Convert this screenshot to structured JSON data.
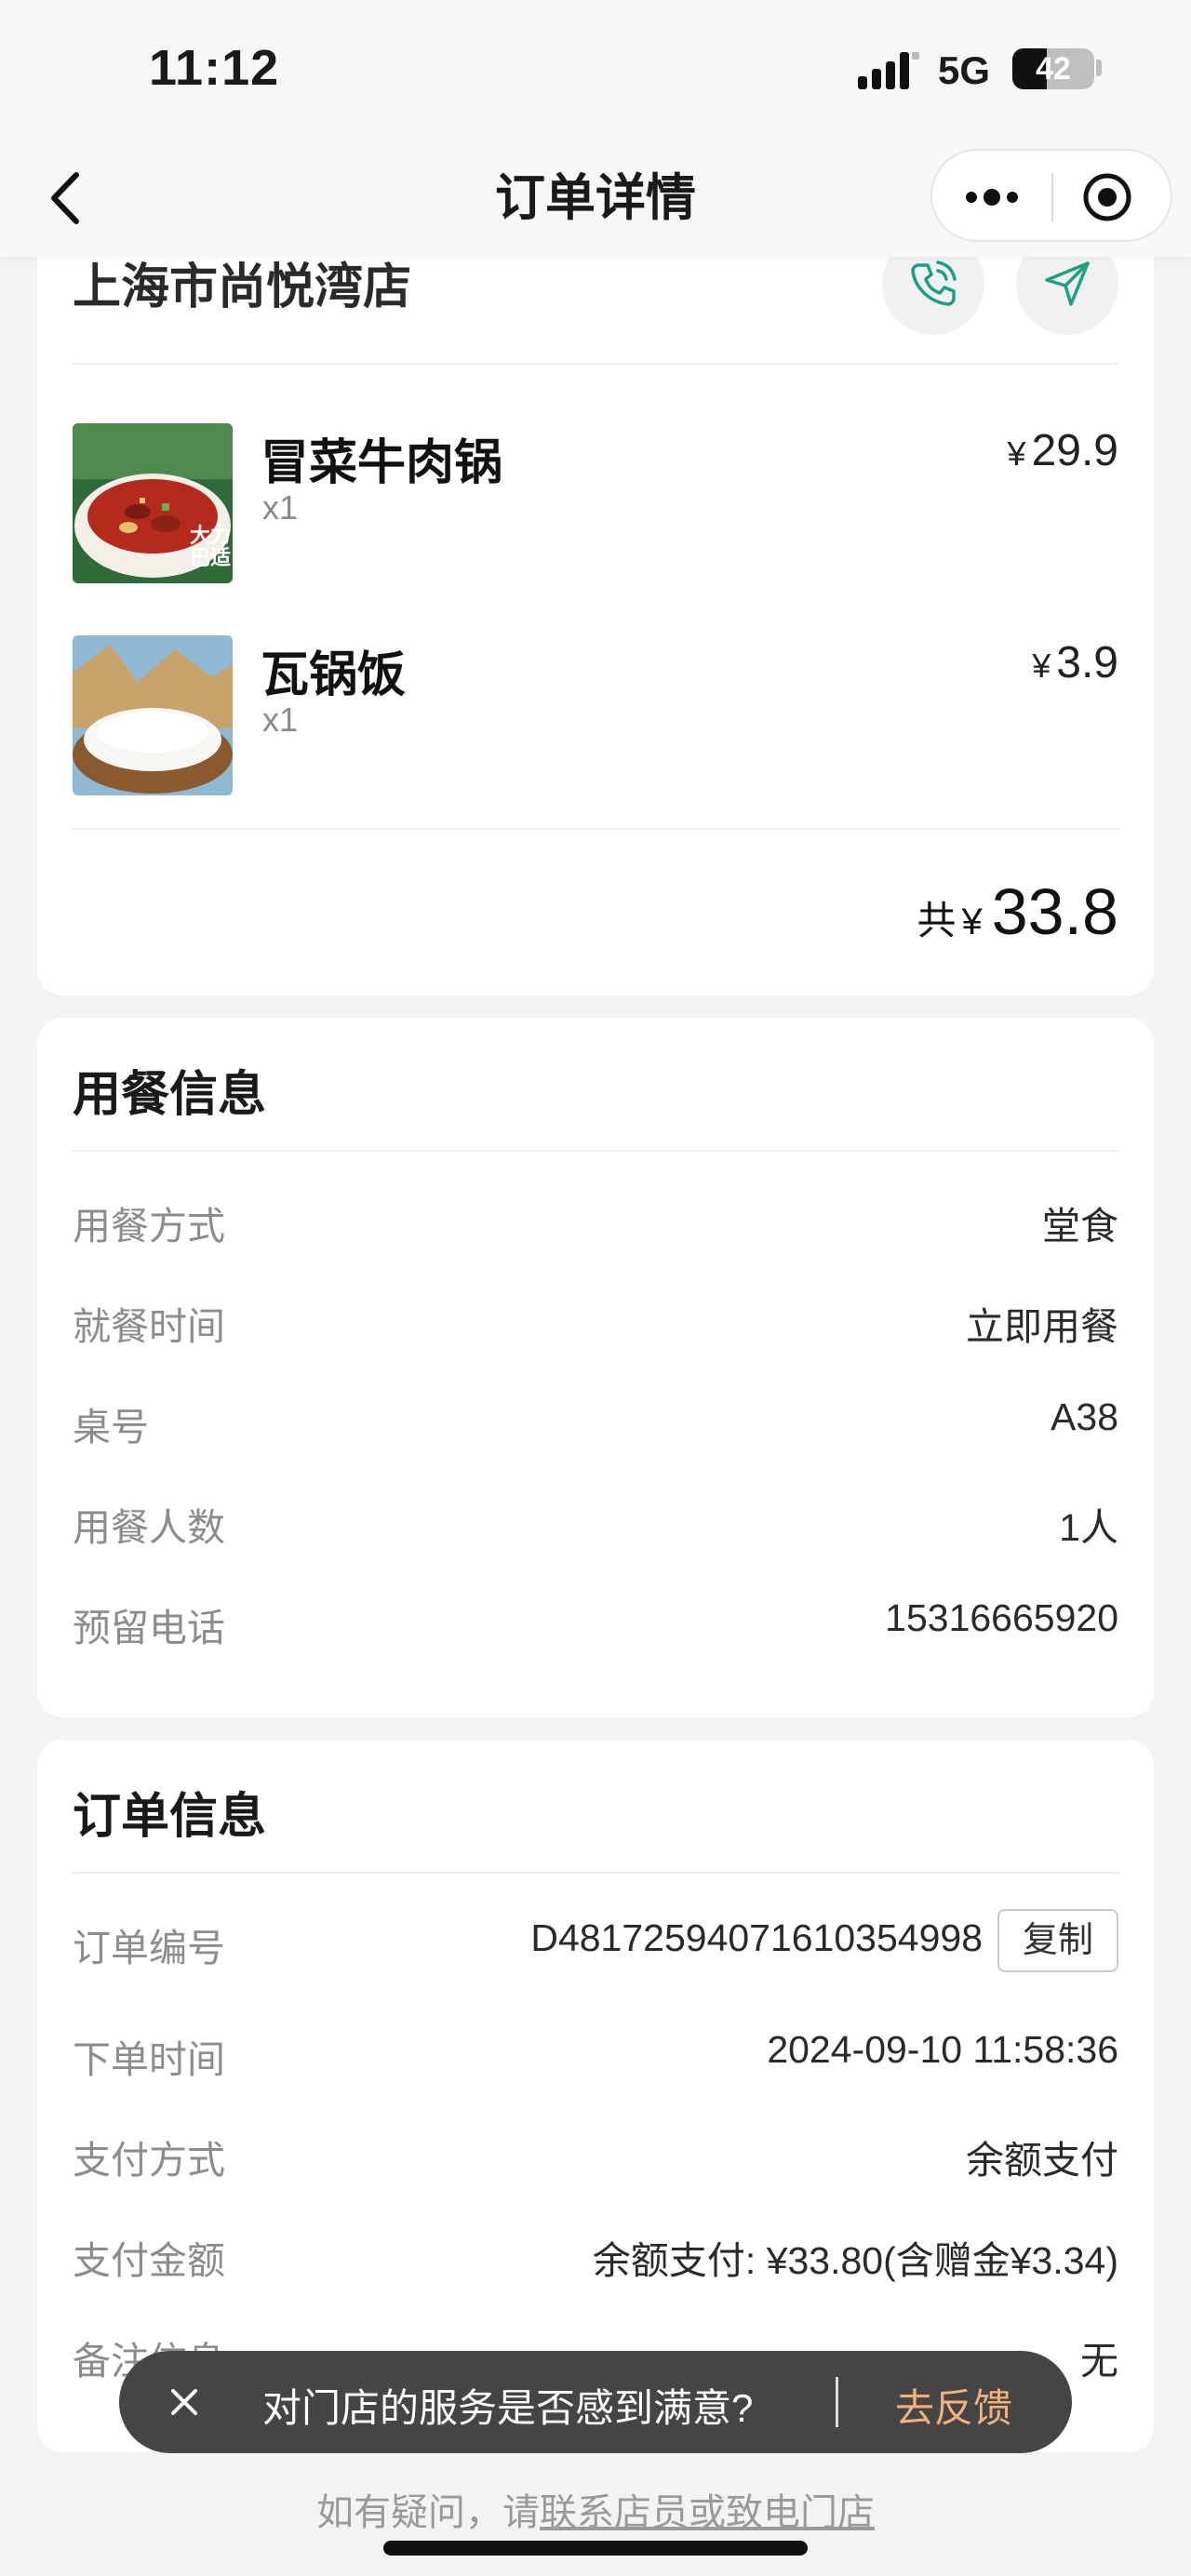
{
  "status": {
    "time": "11:12",
    "network": "5G",
    "battery": "42",
    "battery_level": 0.42
  },
  "nav": {
    "title": "订单详情"
  },
  "store": {
    "name": "上海市尚悦湾店"
  },
  "items": [
    {
      "name": "冒菜牛肉锅",
      "qty": "x1",
      "currency": "¥",
      "price": "29.9",
      "image": "beef-hotpot-image",
      "image_text": "大力\n巴适"
    },
    {
      "name": "瓦锅饭",
      "qty": "x1",
      "currency": "¥",
      "price": "3.9",
      "image": "rice-bowl-image"
    }
  ],
  "total": {
    "prefix": "共",
    "currency": "¥",
    "amount": "33.8"
  },
  "dining": {
    "title": "用餐信息",
    "rows": [
      {
        "key": "用餐方式",
        "value": "堂食"
      },
      {
        "key": "就餐时间",
        "value": "立即用餐"
      },
      {
        "key": "桌号",
        "value": "A38"
      },
      {
        "key": "用餐人数",
        "value": "1人"
      },
      {
        "key": "预留电话",
        "value": "15316665920"
      }
    ]
  },
  "order": {
    "title": "订单信息",
    "copy_label": "复制",
    "rows": [
      {
        "key": "订单编号",
        "value": "D48172594071610354998"
      },
      {
        "key": "下单时间",
        "value": "2024-09-10 11:58:36"
      },
      {
        "key": "支付方式",
        "value": "余额支付"
      },
      {
        "key": "支付金额",
        "value": "余额支付: ¥33.80(含赠金¥3.34)"
      },
      {
        "key": "备注信息",
        "value": "无"
      }
    ]
  },
  "toast": {
    "message": "对门店的服务是否感到满意?",
    "action": "去反馈"
  },
  "footer": {
    "prefix": "如有疑问，请",
    "link": "联系店员或致电门店"
  },
  "colors": {
    "accent": "#1aa084",
    "toast_bg": "#454545",
    "feedback": "#f0b27a"
  }
}
